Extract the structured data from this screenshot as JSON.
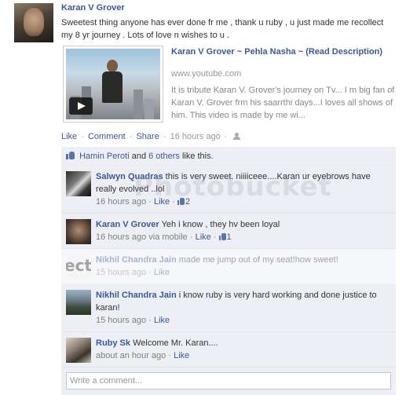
{
  "post": {
    "author": "Karan V Grover",
    "text": "Sweetest thing anyone has ever done fr me , thank u ruby , u just made me recollect my 8 yr journey . Lots of love n wishes to u .",
    "share": {
      "title": "Karan V Grover ~ Pehla Nasha ~ (Read Description)",
      "url": "www.youtube.com",
      "description": "It is tribute Karan V. Grover's journey on Tv... I m big fan of Karan V. Grover frm his saarrthi days...I loves all shows of him. This video is made by me wi..."
    },
    "actions": {
      "like": "Like",
      "comment": "Comment",
      "share": "Share",
      "time": "16 hours ago",
      "sep": "·"
    }
  },
  "likes": {
    "first_name": "Hamin Peroti",
    "and": "and",
    "others": "6 others",
    "suffix": "like this."
  },
  "comments": [
    {
      "name": "Salwyn Quadras",
      "text": "this is very sweet. niiiiceee....Karan ur eyebrows have really evolved ..lol",
      "time": "16 hours ago",
      "like": "Like",
      "likes_count": "2"
    },
    {
      "name": "Karan V Grover",
      "text": "Yeh i know , they hv been loyal",
      "time": "16 hours ago via mobile",
      "like": "Like",
      "likes_count": "1"
    },
    {
      "name": "Nikhil Chandra Jain",
      "text": "made me jump out of my seat!how sweet!",
      "time": "15 hours ago",
      "like": "Like"
    },
    {
      "name": "Nikhil Chandra Jain",
      "text": "i know ruby is very hard working and done justice to karan!",
      "time": "15 hours ago",
      "like": "Like"
    },
    {
      "name": "Ruby Sk",
      "text": "Welcome Mr. Karan....",
      "time": "about an hour ago",
      "like": "Like"
    }
  ],
  "write_comment": {
    "placeholder": "Write a comment..."
  },
  "watermark": {
    "text": "Photobucket"
  },
  "colors": {
    "link": "#3b5998",
    "ufi_bg": "#edeff4",
    "meta": "#999999"
  }
}
